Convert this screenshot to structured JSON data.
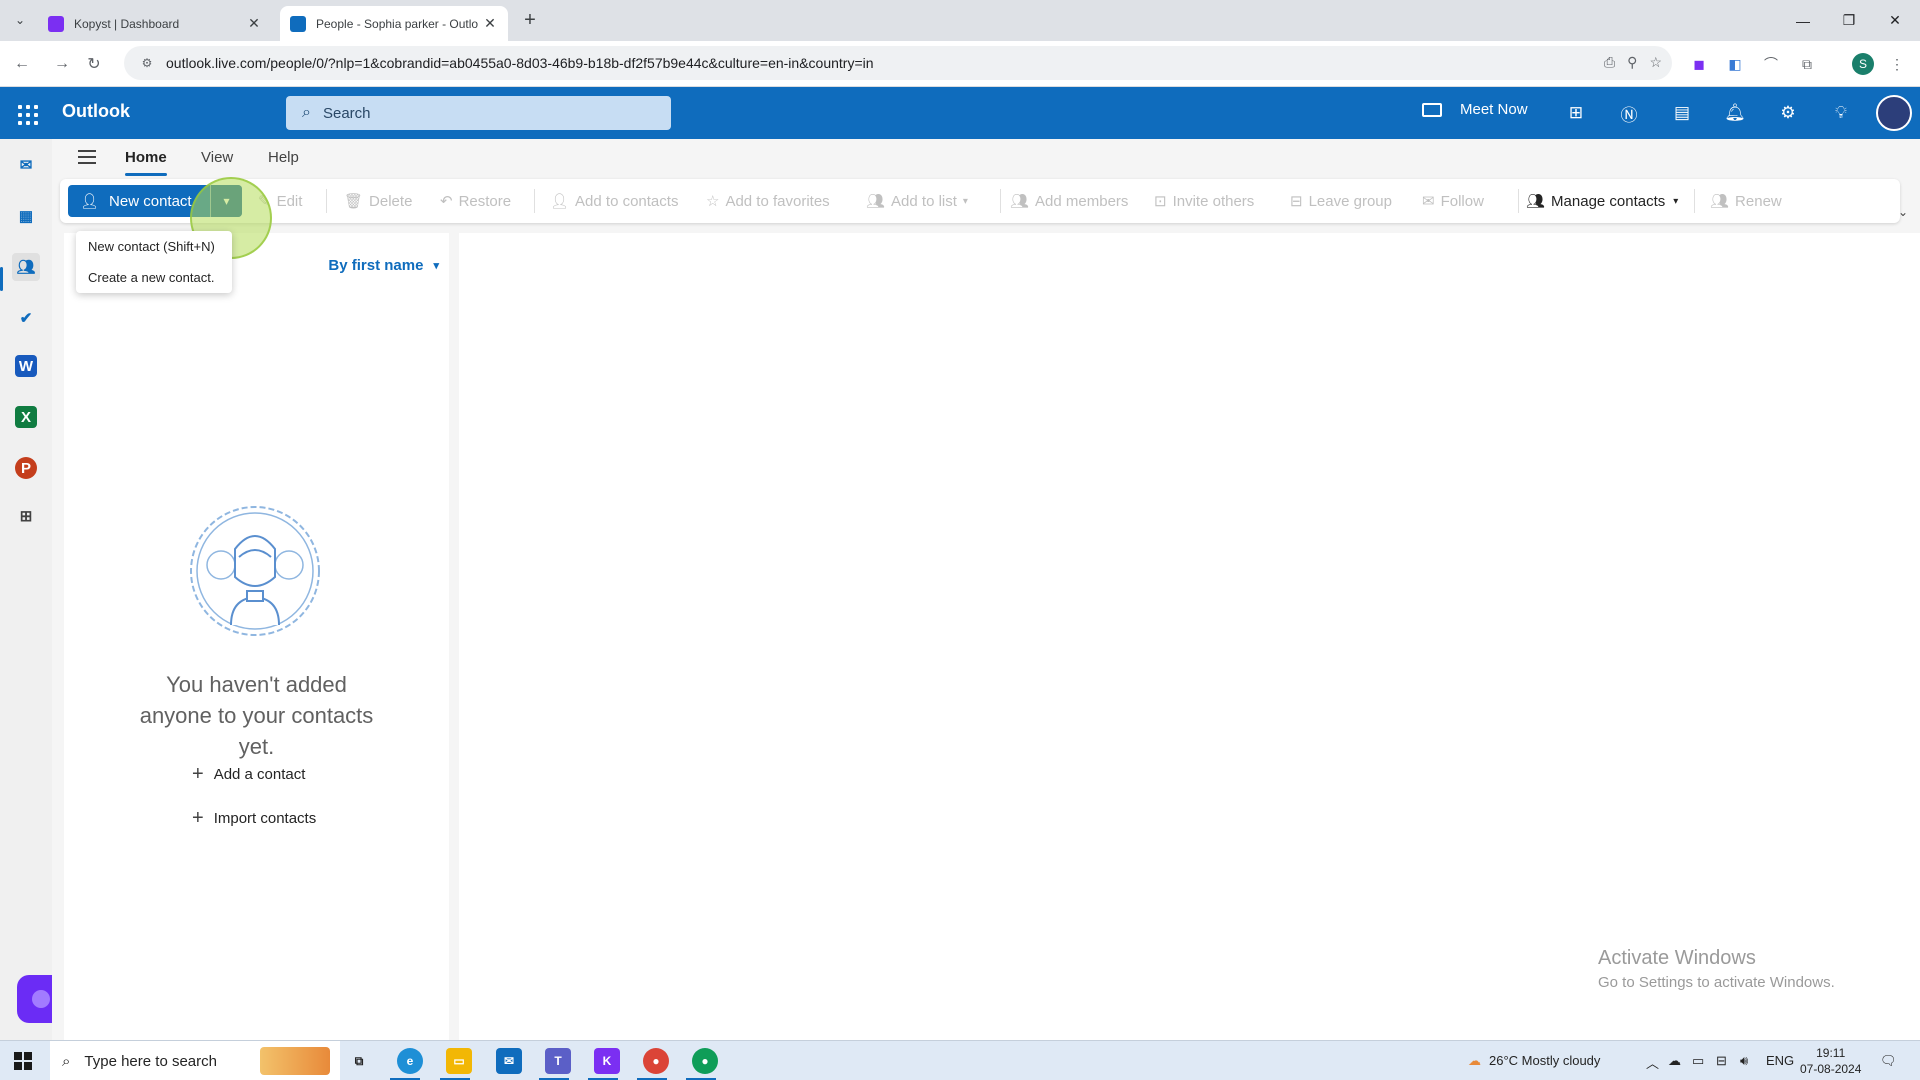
{
  "browser": {
    "tabs": [
      {
        "title": "Kopyst | Dashboard",
        "active": false
      },
      {
        "title": "People - Sophia parker - Outlo",
        "active": true
      }
    ],
    "url": "outlook.live.com/people/0/?nlp=1&cobrandid=ab0455a0-8d03-46b9-b18b-df2f57b9e44c&culture=en-in&country=in",
    "profile_initial": "S"
  },
  "header": {
    "brand": "Outlook",
    "search_placeholder": "Search",
    "meet_now": "Meet Now"
  },
  "ribbon": {
    "tabs": [
      "Home",
      "View",
      "Help"
    ],
    "new_contact": "New contact",
    "buttons": {
      "edit": "Edit",
      "delete": "Delete",
      "restore": "Restore",
      "add_to_contacts": "Add to contacts",
      "add_to_favorites": "Add to favorites",
      "add_to_list": "Add to list",
      "add_members": "Add members",
      "invite_others": "Invite others",
      "leave_group": "Leave group",
      "follow": "Follow",
      "manage_contacts": "Manage contacts",
      "renew": "Renew"
    }
  },
  "tooltip": {
    "line1": "New contact (Shift+N)",
    "line2": "Create a new contact."
  },
  "list": {
    "sort_label": "By first name",
    "empty_message": "You haven't added anyone to your contacts yet.",
    "add_contact": "Add a contact",
    "import_contacts": "Import contacts"
  },
  "watermark": {
    "line1": "Activate Windows",
    "line2": "Go to Settings to activate Windows."
  },
  "taskbar": {
    "search_placeholder": "Type here to search",
    "weather": "26°C  Mostly cloudy",
    "language": "ENG",
    "time": "19:11",
    "date": "07-08-2024"
  },
  "colors": {
    "outlook_blue": "#0f6cbd",
    "header_search": "#c7ddf3",
    "rail_bg": "#f0f0f0",
    "ribbon_bg": "#f5f5f5"
  }
}
